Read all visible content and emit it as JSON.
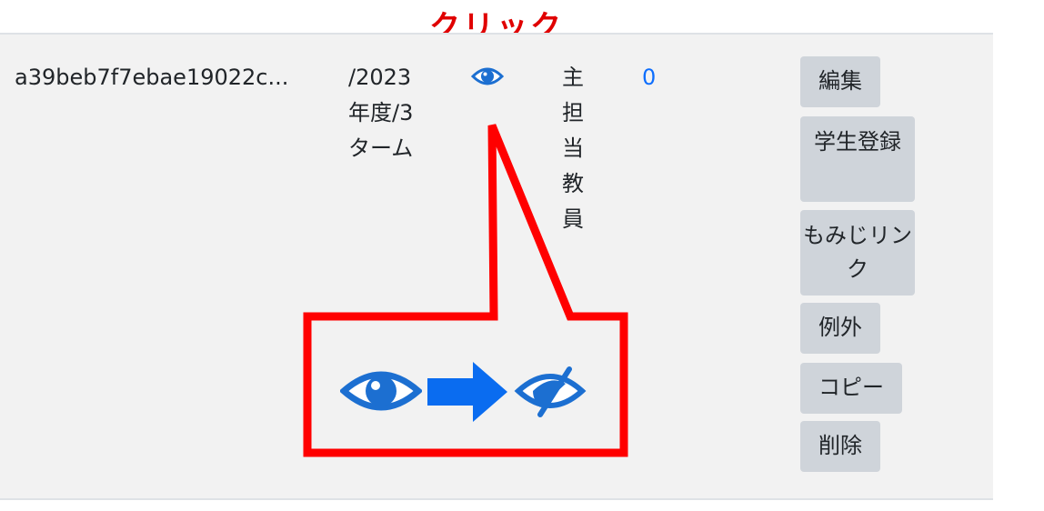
{
  "annotation": {
    "click_label": "クリック"
  },
  "row": {
    "id": "a39beb7f7ebae19022c...",
    "term": "/2023 年度/3 ターム",
    "visibility_icon": "eye-icon",
    "role": "主担当教員",
    "count": "0",
    "buttons": {
      "edit": "編集",
      "register": "学生登録",
      "link": "もみじリンク",
      "exception": "例外",
      "copy": "コピー",
      "delete": "削除"
    }
  },
  "callout": {
    "from_icon": "eye-icon",
    "arrow_icon": "right-arrow-icon",
    "to_icon": "eye-slash-icon"
  },
  "colors": {
    "link_blue": "#0d6efd",
    "annotation_red": "#e00000",
    "icon_blue": "#1c6fd1",
    "arrow_blue": "#0a6cf0",
    "button_gray": "#cfd4da",
    "row_bg": "#f2f2f2"
  }
}
